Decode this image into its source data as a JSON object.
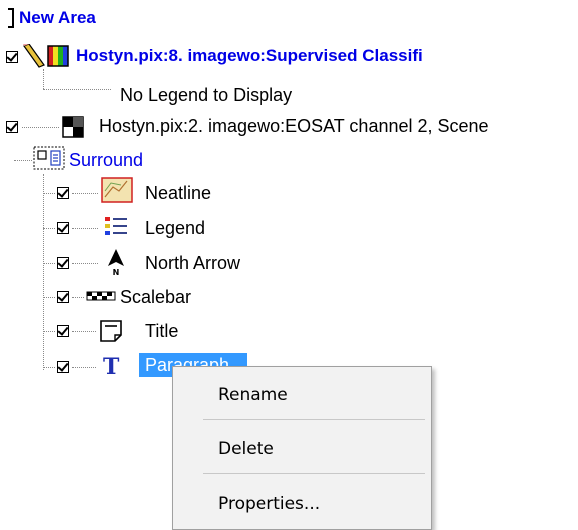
{
  "tree": {
    "root": {
      "label": "New Area"
    },
    "layers": [
      {
        "label": "Hostyn.pix:8. imagewo:Supervised Classifi",
        "sublabel": "No Legend to Display",
        "checked": true,
        "icon": "pencil-palette-icon"
      },
      {
        "label": "Hostyn.pix:2. imagewo:EOSAT channel 2,  Scene",
        "checked": true,
        "icon": "grid-icon"
      }
    ],
    "surround": {
      "label": "Surround",
      "icon": "surround-icon",
      "items": [
        {
          "label": "Neatline",
          "checked": true,
          "icon": "neatline-icon"
        },
        {
          "label": "Legend",
          "checked": true,
          "icon": "legend-icon"
        },
        {
          "label": "North Arrow",
          "checked": true,
          "icon": "north-arrow-icon"
        },
        {
          "label": "Scalebar",
          "checked": true,
          "icon": "scalebar-icon"
        },
        {
          "label": "Title",
          "checked": true,
          "icon": "title-icon"
        },
        {
          "label": "Paragraph",
          "checked": true,
          "icon": "paragraph-icon",
          "selected": true
        }
      ]
    }
  },
  "context_menu": {
    "items": [
      {
        "label": "Rename"
      },
      {
        "label": "Delete"
      },
      {
        "label": "Properties..."
      }
    ]
  },
  "colors": {
    "link_blue": "#0000e6",
    "selection": "#3399ff",
    "menu_bg": "#f2f2f2"
  }
}
